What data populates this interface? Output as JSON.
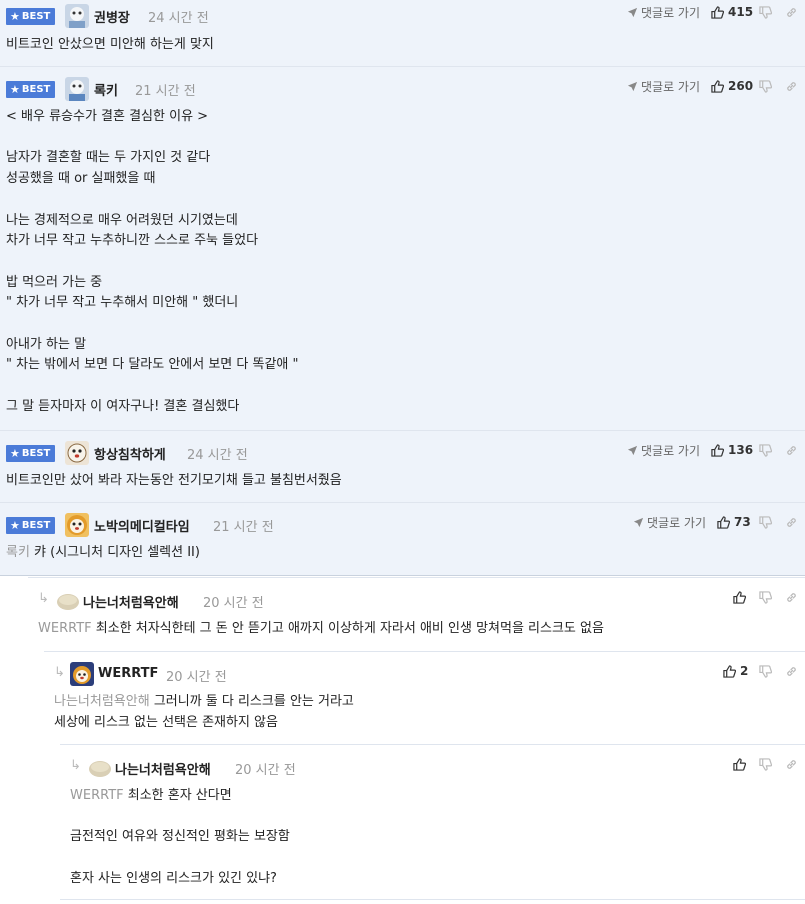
{
  "labels": {
    "best": "BEST",
    "goto_reply": "댓글로 가기"
  },
  "colors": {
    "best_bg": "#eef3fa",
    "badge": "#4b7bd8",
    "divider": "#dfe5ee"
  },
  "comments": [
    {
      "nick": "권병장",
      "time": "24 시간 전",
      "likes": "415",
      "text": "비트코인 안샀으면 미안해 하는게 맞지"
    },
    {
      "nick": "록키",
      "time": "21 시간 전",
      "likes": "260",
      "text": "< 배우 류승수가 결혼 결심한 이유 >\n\n남자가 결혼할 때는 두 가지인 것 같다\n성공했을 때 or 실패했을 때\n\n나는 경제적으로 매우 어려웠던 시기였는데\n차가 너무 작고 누추하니깐 스스로 주눅 들었다\n\n밥 먹으러 가는 중\n\" 차가 너무 작고 누추해서 미안해 \" 했더니\n\n아내가 하는 말\n\" 차는 밖에서 보면 다 달라도 안에서 보면 다 똑같애 \"\n\n그 말 듣자마자 이 여자구나! 결혼 결심했다"
    },
    {
      "nick": "항상침착하게",
      "time": "24 시간 전",
      "likes": "136",
      "text": "비트코인만 샀어 봐라 자는동안 전기모기채 들고 불침번서줬음"
    },
    {
      "nick": "노박의메디컬타임",
      "time": "21 시간 전",
      "likes": "73",
      "reply_to": "록키",
      "text": " 캬 (시그니처 디자인 셀렉션 II)"
    }
  ],
  "replies": [
    {
      "nick": "나는너처럼욕안해",
      "time": "20 시간 전",
      "likes": "",
      "reply_to": "WERRTF",
      "text": " 최소한 처자식한테 그 돈 안 뜯기고 애까지 이상하게 자라서 애비 인생 망쳐먹을 리스크도 없음"
    },
    {
      "nick": "WERRTF",
      "time": "20 시간 전",
      "likes": "2",
      "reply_to": "나는너처럼욕안해",
      "text_first": " 그러니까 둘 다 리스크를 안는 거라고",
      "text_rest": "세상에 리스크 없는 선택은 존재하지 않음"
    },
    {
      "nick": "나는너처럼욕안해",
      "time": "20 시간 전",
      "likes": "",
      "reply_to": "WERRTF",
      "text_first": " 최소한 혼자 산다면",
      "text_rest": "\n금전적인 여유와 정신적인 평화는 보장함\n\n혼자 사는 인생의 리스크가 있긴 있냐?"
    }
  ]
}
